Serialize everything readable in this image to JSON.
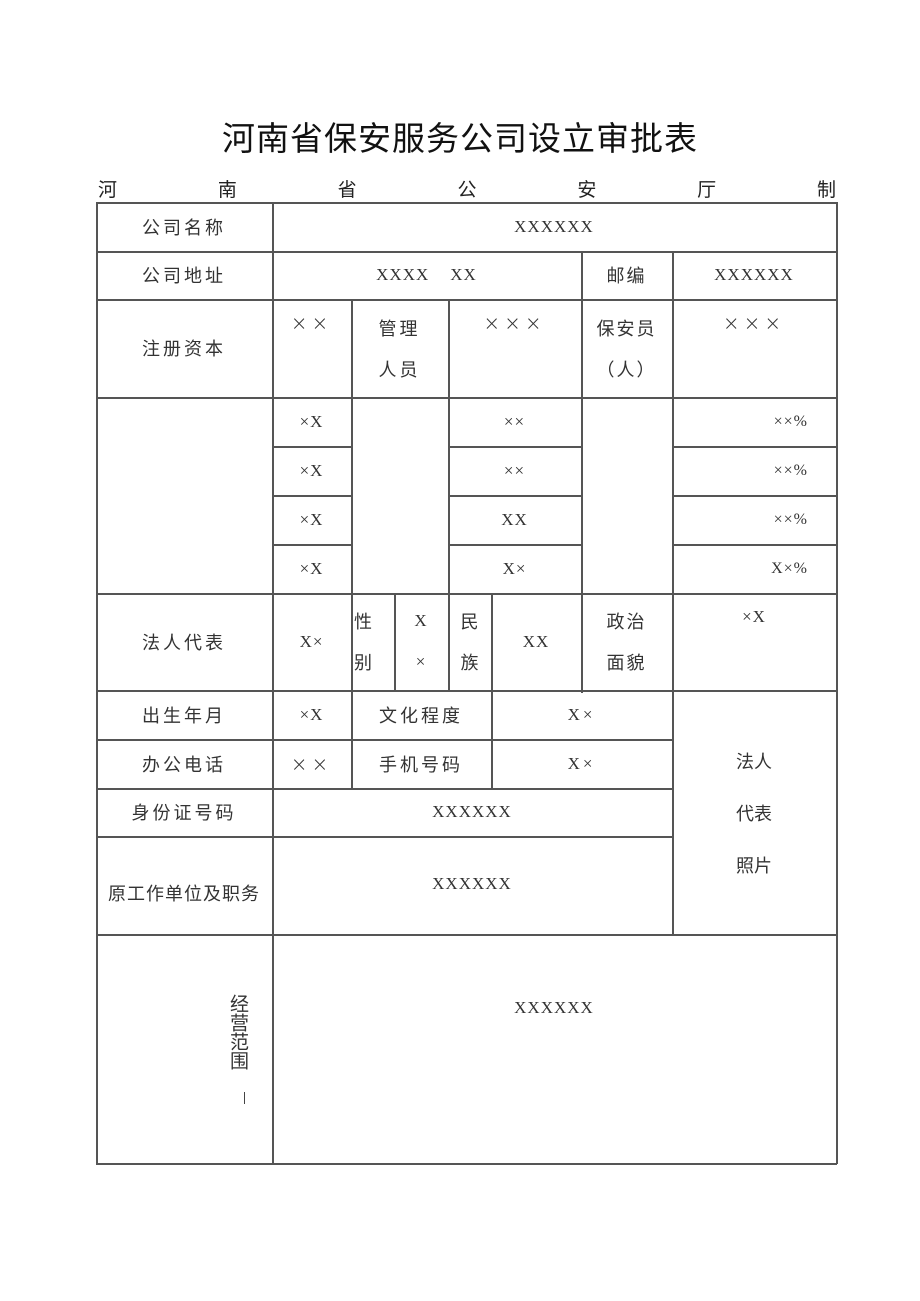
{
  "document": {
    "title": "河南省保安服务公司设立审批表",
    "issuer_chars": [
      "河",
      "南",
      "省",
      "公",
      "安",
      "厅",
      "制"
    ]
  },
  "form": {
    "company_name": {
      "label": "公司名称",
      "value": "XXXXXX"
    },
    "company_address": {
      "label": "公司地址",
      "value": "XXXX    XX"
    },
    "postal_code": {
      "label": "邮编",
      "value": "XXXXXX"
    },
    "registered_capital": {
      "label": "注册资本",
      "value": "××"
    },
    "managers": {
      "label_line1": "管理",
      "label_line2": "人员",
      "value": "×××"
    },
    "guards": {
      "label_line1": "保安员",
      "label_line2": "（人）",
      "value": "×××"
    },
    "shareholders": {
      "col1": [
        "×X",
        "×X",
        "×X",
        "×X"
      ],
      "col2": [
        "××",
        "××",
        "XX",
        "X×"
      ],
      "col3": [
        "××%",
        "××%",
        "××%",
        "X×%"
      ]
    },
    "legal_rep": {
      "label": "法人代表",
      "value": "X×"
    },
    "gender": {
      "label_line1": "性",
      "label_line2": "别",
      "value_line1": "X",
      "value_line2": "×"
    },
    "ethnicity": {
      "label_line1": "民",
      "label_line2": "族",
      "value": "XX"
    },
    "political_status": {
      "label_line1": "政治",
      "label_line2": "面貌",
      "value": "×X"
    },
    "birth_date": {
      "label": "出生年月",
      "value": "×X"
    },
    "education": {
      "label": "文化程度",
      "value": "X×"
    },
    "office_phone": {
      "label": "办公电话",
      "value": "××"
    },
    "mobile": {
      "label": "手机号码",
      "value": "X×"
    },
    "photo": {
      "line1": "法人",
      "line2": "代表",
      "line3": "照片"
    },
    "id_number": {
      "label": "身份证号码",
      "value": "XXXXXX"
    },
    "previous_employer": {
      "label": "原工作单位及职务",
      "value": "XXXXXX"
    },
    "business_scope": {
      "label": "经营范围",
      "value": "XXXXXX"
    }
  }
}
